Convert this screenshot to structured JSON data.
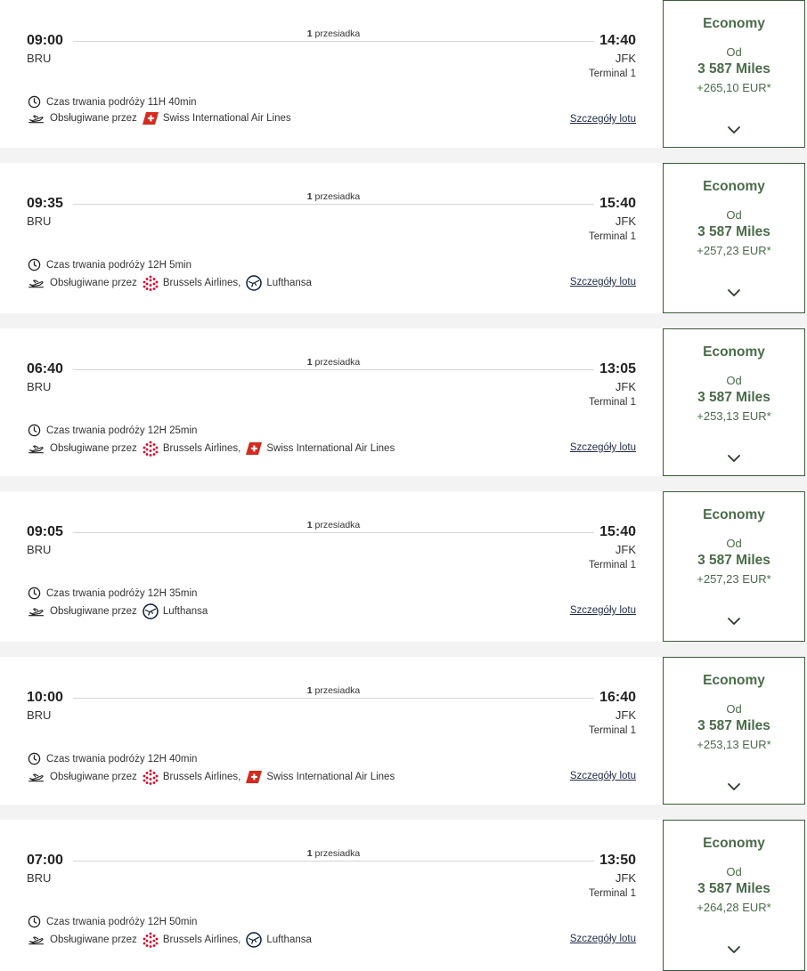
{
  "labels": {
    "duration_prefix": "Czas trwania podróży",
    "operated_prefix": "Obsługiwane przez",
    "details_link": "Szczegóły lotu",
    "stops_count": "1",
    "stops_word": "przesiadka",
    "from": "Od"
  },
  "flights": [
    {
      "dep_time": "09:00",
      "dep_code": "BRU",
      "arr_time": "14:40",
      "arr_code": "JFK",
      "terminal": "Terminal 1",
      "duration": "11H 40min",
      "airlines": [
        {
          "name": "Swiss International Air Lines",
          "logo": "swiss-logo"
        }
      ],
      "fare": {
        "cabin": "Economy",
        "miles": "3 587 Miles",
        "eur": "+265,10 EUR*"
      }
    },
    {
      "dep_time": "09:35",
      "dep_code": "BRU",
      "arr_time": "15:40",
      "arr_code": "JFK",
      "terminal": "Terminal 1",
      "duration": "12H 5min",
      "airlines": [
        {
          "name": "Brussels Airlines,",
          "logo": "brussels-logo"
        },
        {
          "name": "Lufthansa",
          "logo": "lufthansa-logo"
        }
      ],
      "fare": {
        "cabin": "Economy",
        "miles": "3 587 Miles",
        "eur": "+257,23 EUR*"
      }
    },
    {
      "dep_time": "06:40",
      "dep_code": "BRU",
      "arr_time": "13:05",
      "arr_code": "JFK",
      "terminal": "Terminal 1",
      "duration": "12H 25min",
      "airlines": [
        {
          "name": "Brussels Airlines,",
          "logo": "brussels-logo"
        },
        {
          "name": "Swiss International Air Lines",
          "logo": "swiss-logo"
        }
      ],
      "fare": {
        "cabin": "Economy",
        "miles": "3 587 Miles",
        "eur": "+253,13 EUR*"
      }
    },
    {
      "dep_time": "09:05",
      "dep_code": "BRU",
      "arr_time": "15:40",
      "arr_code": "JFK",
      "terminal": "Terminal 1",
      "duration": "12H 35min",
      "airlines": [
        {
          "name": "Lufthansa",
          "logo": "lufthansa-logo"
        }
      ],
      "fare": {
        "cabin": "Economy",
        "miles": "3 587 Miles",
        "eur": "+257,23 EUR*"
      }
    },
    {
      "dep_time": "10:00",
      "dep_code": "BRU",
      "arr_time": "16:40",
      "arr_code": "JFK",
      "terminal": "Terminal 1",
      "duration": "12H 40min",
      "airlines": [
        {
          "name": "Brussels Airlines,",
          "logo": "brussels-logo"
        },
        {
          "name": "Swiss International Air Lines",
          "logo": "swiss-logo"
        }
      ],
      "fare": {
        "cabin": "Economy",
        "miles": "3 587 Miles",
        "eur": "+253,13 EUR*"
      }
    },
    {
      "dep_time": "07:00",
      "dep_code": "BRU",
      "arr_time": "13:50",
      "arr_code": "JFK",
      "terminal": "Terminal 1",
      "duration": "12H 50min",
      "airlines": [
        {
          "name": "Brussels Airlines,",
          "logo": "brussels-logo"
        },
        {
          "name": "Lufthansa",
          "logo": "lufthansa-logo"
        }
      ],
      "fare": {
        "cabin": "Economy",
        "miles": "3 587 Miles",
        "eur": "+264,28 EUR*"
      }
    }
  ],
  "colors": {
    "fare_text": "#4a6b4a",
    "fare_border": "#3b5a3a",
    "swiss_red": "#d52b1e",
    "brussels_red": "#d6002a",
    "lufthansa_navy": "#0a1d3d"
  }
}
